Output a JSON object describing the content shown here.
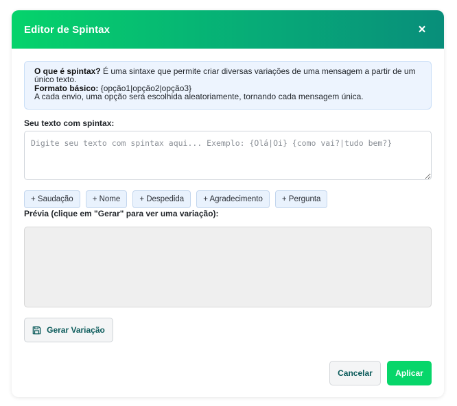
{
  "modal": {
    "title": "Editor de Spintax",
    "close_symbol": "×"
  },
  "info": {
    "what_label": "O que é spintax?",
    "what_text": " É uma sintaxe que permite criar diversas variações de uma mensagem a partir de um único texto.",
    "format_label": "Formato básico:",
    "format_text": " {opção1|opção2|opção3}",
    "usage_text": "A cada envio, uma opção será escolhida aleatoriamente, tornando cada mensagem única."
  },
  "editor": {
    "label": "Seu texto com spintax:",
    "value": "",
    "placeholder": "Digite seu texto com spintax aqui... Exemplo: {Olá|Oi} {como vai?|tudo bem?}"
  },
  "chips": [
    "+ Saudação",
    "+ Nome",
    "+ Despedida",
    "+ Agradecimento",
    "+ Pergunta"
  ],
  "preview": {
    "label": "Prévia (clique em \"Gerar\" para ver uma variação):",
    "content": ""
  },
  "buttons": {
    "generate": "Gerar Variação",
    "generate_icon": "save-icon",
    "cancel": "Cancelar",
    "apply": "Aplicar"
  },
  "colors": {
    "header_start": "#05d36b",
    "header_end": "#088e7a",
    "accent": "#07d66a",
    "info_bg": "#edf4fe",
    "chip_bg": "#e9f2fd",
    "preview_bg": "#efefef",
    "secondary_text": "#0d5c5c"
  }
}
